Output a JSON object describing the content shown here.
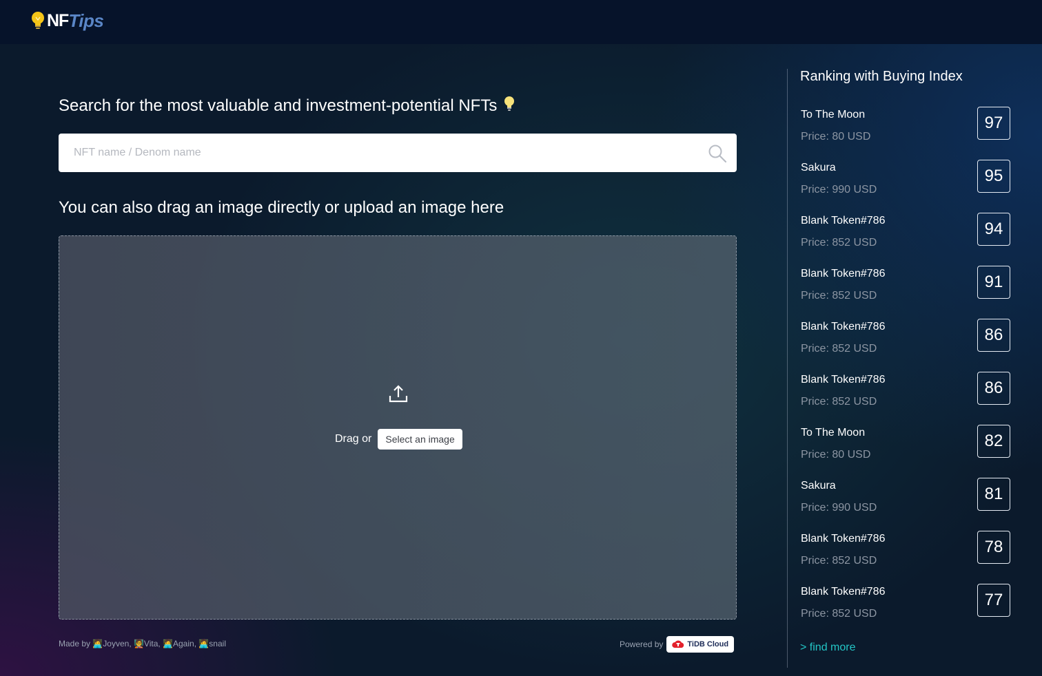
{
  "header": {
    "logo_part1": "NF",
    "logo_part2": "Tips"
  },
  "main": {
    "headline": "Search for the most valuable and investment-potential NFTs",
    "search_placeholder": "NFT name / Denom name",
    "search_value": "",
    "upload_headline": "You can also drag an image directly or upload an image here",
    "drag_label": "Drag or",
    "select_button": "Select an image"
  },
  "footer": {
    "credits": "Made by 🧑‍💻Joyven, 🧑‍🏫Vita, 🧑‍💻Again, 🧑‍💻snail",
    "powered_by": "Powered by",
    "tidb_label": "TiDB Cloud"
  },
  "ranking": {
    "title": "Ranking with Buying Index",
    "items": [
      {
        "name": "To The Moon",
        "price": "Price: 80 USD",
        "score": "97"
      },
      {
        "name": "Sakura",
        "price": "Price: 990 USD",
        "score": "95"
      },
      {
        "name": "Blank Token#786",
        "price": "Price: 852 USD",
        "score": "94"
      },
      {
        "name": "Blank Token#786",
        "price": "Price: 852 USD",
        "score": "91"
      },
      {
        "name": "Blank Token#786",
        "price": "Price: 852 USD",
        "score": "86"
      },
      {
        "name": "Blank Token#786",
        "price": "Price: 852 USD",
        "score": "86"
      },
      {
        "name": "To The Moon",
        "price": "Price: 80 USD",
        "score": "82"
      },
      {
        "name": "Sakura",
        "price": "Price: 990 USD",
        "score": "81"
      },
      {
        "name": "Blank Token#786",
        "price": "Price: 852 USD",
        "score": "78"
      },
      {
        "name": "Blank Token#786",
        "price": "Price: 852 USD",
        "score": "77"
      }
    ],
    "find_more": "> find more"
  },
  "colors": {
    "accent": "#23c6c6",
    "logo_tips": "#5a86c6",
    "bulb": "#f5c518",
    "tidb_red": "#e3202b"
  },
  "icons": {
    "logo": "lightbulb-icon",
    "headline": "lightbulb-icon",
    "search": "search-icon",
    "upload": "upload-icon",
    "tidb": "tidb-cloud-icon"
  }
}
